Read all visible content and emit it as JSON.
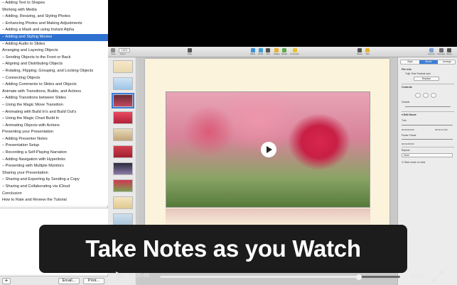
{
  "toc": {
    "selected_index": 5,
    "items": [
      "– Adding Text to Shapes",
      "Working with Media",
      "– Adding, Resizing, and Styling Photos",
      "– Enhancing Photos and Making Adjustments",
      "– Adding a Mask and using Instant Alpha",
      "– Adding and Styling Movies",
      "– Adding Audio to Slides",
      "Arranging and Layering Objects",
      "– Sending Objects to the Front or Back",
      "– Aligning and Distributing Objects",
      "– Rotating, Flipping, Grouping, and Locking Objects",
      "– Connecting Objects",
      "– Adding Comments to Slides and Objects",
      "Animate with Transitions, Builds, and Actions",
      "– Adding Transitions between Slides",
      "– Using the Magic Move Transition",
      "– Animating with Build In's and Build Out's",
      "– Using the Magic Chart Build In",
      "– Animating Objects with Actions",
      "Presenting your Presentation",
      "– Adding Presenter Notes",
      "– Presentation Setup",
      "– Recording a Self-Playing Narration",
      "– Adding Navigation with Hyperlinks",
      "– Presenting with Multiple Monitors",
      "Sharing your Presentation",
      "– Sharing and Exporting by Sending a Copy",
      "– Sharing and Collaborating via iCloud",
      "Conclusion",
      "How to Rate and Review the Tutorial"
    ]
  },
  "notes": {
    "value": ""
  },
  "bottom_bar": {
    "add_label": "+",
    "email_label": "Email...",
    "print_label": "Print..."
  },
  "caption": {
    "text": "Take Notes as you Watch"
  },
  "player": {
    "elapsed": "05:48",
    "total": "07:01",
    "progress": 0.827
  },
  "keynote": {
    "zoom": "100%",
    "toolbar": [
      "View",
      "Zoom",
      "Play",
      "Table",
      "Chart",
      "Text",
      "Shape",
      "Media",
      "Comment",
      "Share",
      "Tips",
      "Format",
      "Animate",
      "Setup"
    ],
    "inspector": {
      "tabs": [
        "Style",
        "Movie",
        "Arrange"
      ],
      "active_tab": 1,
      "file_info_label": "File Info",
      "file_name": "Tulip Time Festival.mp4",
      "replace_label": "Replace",
      "controls_label": "Controls",
      "volume_label": "Volume",
      "edit_movie_label": "Edit Movie",
      "trim_label": "Trim",
      "trim_start": "00:00:00.000",
      "trim_end": "00:01:01.000",
      "poster_frame_label": "Poster Frame",
      "poster_frame_value": "00:00:28.000",
      "repeat_label": "Repeat:",
      "repeat_value": "None",
      "start_on_click_label": "Start movie on click"
    }
  },
  "colors": {
    "selection_blue": "#2f71cf",
    "banner_bg": "#1c1c1c",
    "tulip_red": "#d9264c"
  }
}
